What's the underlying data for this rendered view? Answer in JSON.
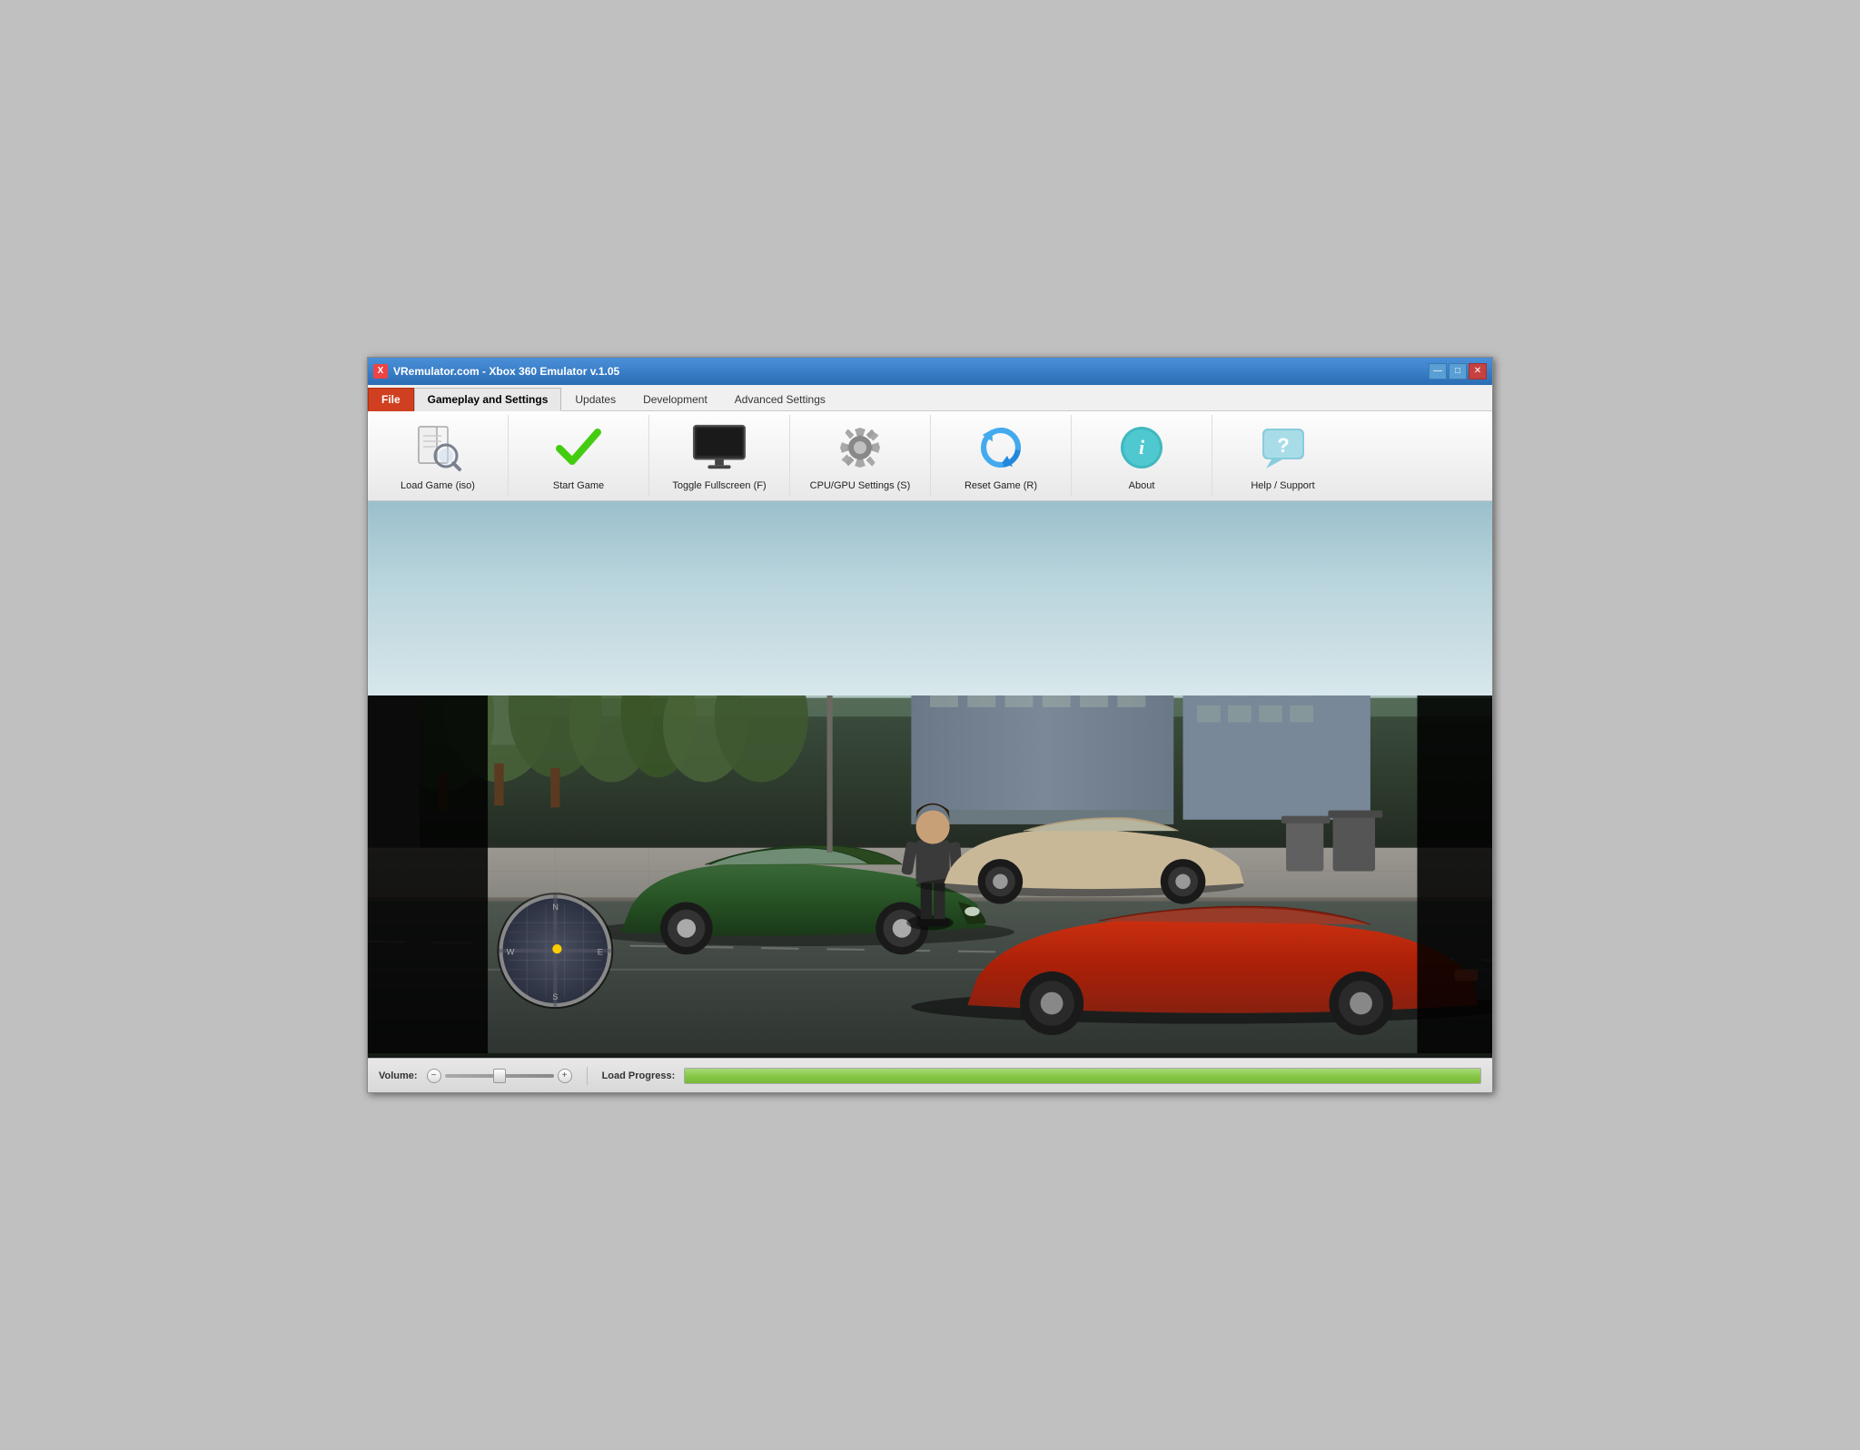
{
  "window": {
    "title": "VRemulator.com - Xbox 360 Emulator v.1.05",
    "icon_label": "X"
  },
  "title_bar_controls": {
    "minimize": "—",
    "maximize": "□",
    "close": "✕"
  },
  "menu_tabs": [
    {
      "id": "file",
      "label": "File",
      "active": false,
      "special": "file"
    },
    {
      "id": "gameplay",
      "label": "Gameplay and Settings",
      "active": true,
      "special": ""
    },
    {
      "id": "updates",
      "label": "Updates",
      "active": false,
      "special": ""
    },
    {
      "id": "development",
      "label": "Development",
      "active": false,
      "special": ""
    },
    {
      "id": "advanced",
      "label": "Advanced Settings",
      "active": false,
      "special": ""
    }
  ],
  "toolbar_items": [
    {
      "id": "load-game",
      "label": "Load Game (iso)"
    },
    {
      "id": "start-game",
      "label": "Start Game"
    },
    {
      "id": "toggle-fullscreen",
      "label": "Toggle Fullscreen (F)"
    },
    {
      "id": "cpu-gpu-settings",
      "label": "CPU/GPU Settings (S)"
    },
    {
      "id": "reset-game",
      "label": "Reset Game (R)"
    },
    {
      "id": "about",
      "label": "About"
    },
    {
      "id": "help-support",
      "label": "Help / Support"
    }
  ],
  "status_bar": {
    "volume_label": "Volume:",
    "vol_minus": "−",
    "vol_plus": "+",
    "load_progress_label": "Load Progress:",
    "progress_value": 100
  }
}
